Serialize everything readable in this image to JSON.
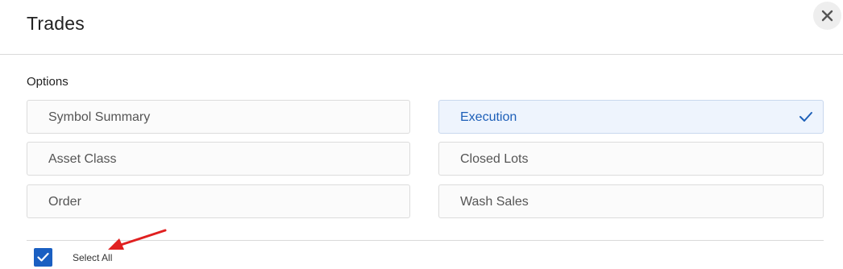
{
  "dialog": {
    "title": "Trades",
    "close_icon": "close-icon"
  },
  "options": {
    "section_label": "Options",
    "items": [
      {
        "label": "Symbol Summary",
        "selected": false
      },
      {
        "label": "Execution",
        "selected": true
      },
      {
        "label": "Asset Class",
        "selected": false
      },
      {
        "label": "Closed Lots",
        "selected": false
      },
      {
        "label": "Order",
        "selected": false
      },
      {
        "label": "Wash Sales",
        "selected": false
      }
    ]
  },
  "footer": {
    "select_all_label": "Select All",
    "select_all_checked": true
  },
  "colors": {
    "accent": "#1a5fc2",
    "annotation_arrow": "#e02020"
  }
}
